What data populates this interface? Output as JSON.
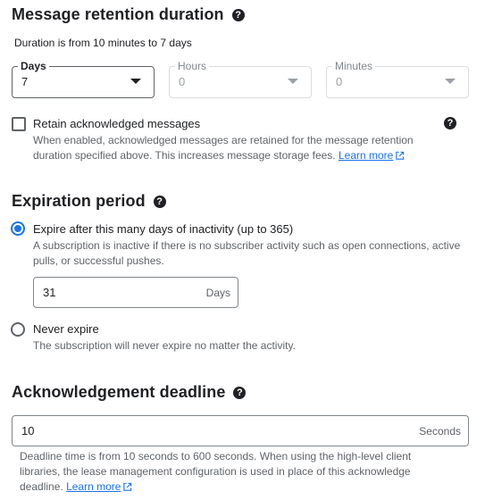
{
  "retention": {
    "title": "Message retention duration",
    "subtitle": "Duration is from 10 minutes to 7 days",
    "days": {
      "label": "Days",
      "value": "7"
    },
    "hours": {
      "label": "Hours",
      "value": "0"
    },
    "minutes": {
      "label": "Minutes",
      "value": "0"
    },
    "retain_ack": {
      "label": "Retain acknowledged messages",
      "checked": false,
      "desc_line1": "When enabled, acknowledged messages are retained for the message retention",
      "desc_line2": "duration specified above. This increases message storage fees.",
      "learn_more": "Learn more"
    }
  },
  "expiration": {
    "title": "Expiration period",
    "option_expire": {
      "label": "Expire after this many days of inactivity (up to 365)",
      "desc_line1": "A subscription is inactive if there is no subscriber activity such as open connections, active",
      "desc_line2": "pulls, or successful pushes.",
      "selected": true
    },
    "days_input": {
      "value": "31",
      "suffix": "Days"
    },
    "option_never": {
      "label": "Never expire",
      "desc": "The subscription will never expire no matter the activity.",
      "selected": false
    }
  },
  "ack_deadline": {
    "title": "Acknowledgement deadline",
    "value": "10",
    "suffix": "Seconds",
    "desc_line1": "Deadline time is from 10 seconds to 600 seconds. When using the high-level client",
    "desc_line2": "libraries, the lease management configuration is used in place of this acknowledge",
    "desc_line3": "deadline.",
    "learn_more": "Learn more"
  },
  "colors": {
    "accent": "#1a73e8",
    "text": "#202124",
    "muted": "#5f6368",
    "border": "#dadce0"
  },
  "icons": {
    "help": "help-circle-icon",
    "external": "open-in-new-icon",
    "dropdown": "arrow-drop-down-icon"
  }
}
